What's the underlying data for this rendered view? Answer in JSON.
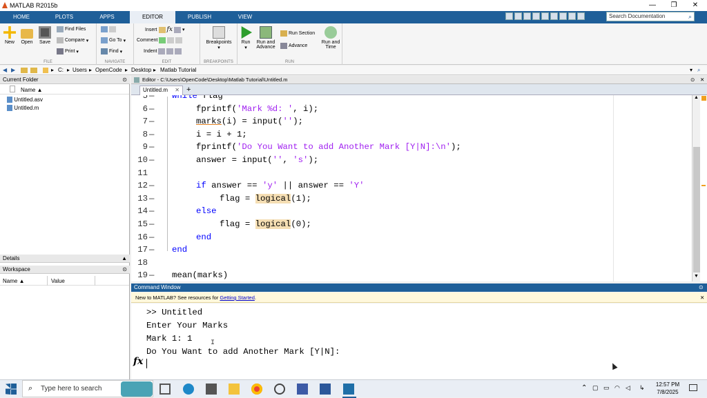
{
  "window": {
    "title": "MATLAB R2015b",
    "min": "—",
    "max": "❐",
    "close": "✕"
  },
  "ribbon_tabs": [
    "HOME",
    "PLOTS",
    "APPS",
    "EDITOR",
    "PUBLISH",
    "VIEW"
  ],
  "search": {
    "placeholder": "Search Documentation"
  },
  "ribbon": {
    "file": {
      "new": "New",
      "open": "Open",
      "save": "Save",
      "find_files": "Find Files",
      "compare": "Compare",
      "print": "Print",
      "group": "FILE"
    },
    "navigate": {
      "go_to": "Go To",
      "find": "Find",
      "group": "NAVIGATE"
    },
    "edit": {
      "insert": "Insert",
      "comment": "Comment",
      "indent": "Indent",
      "group": "EDIT"
    },
    "breakpoints": {
      "label": "Breakpoints",
      "group": "BREAKPOINTS"
    },
    "run": {
      "run": "Run",
      "run_advance": "Run and Advance",
      "run_section": "Run Section",
      "advance": "Advance",
      "run_time": "Run and Time",
      "group": "RUN"
    }
  },
  "address": {
    "drive": "C:",
    "parts": [
      "Users",
      "OpenCode",
      "Desktop",
      "Matlab Tutorial"
    ]
  },
  "current_folder": {
    "title": "Current Folder",
    "col_name": "Name ▲",
    "files": [
      "Untitled.asv",
      "Untitled.m"
    ]
  },
  "details": {
    "title": "Details"
  },
  "workspace": {
    "title": "Workspace",
    "col_name": "Name ▲",
    "col_value": "Value"
  },
  "editor": {
    "header": "Editor - C:\\Users\\OpenCode\\Desktop\\Matlab Tutorial\\Untitled.m",
    "tab": "Untitled.m",
    "lines": [
      {
        "n": "5",
        "dash": "—",
        "indent": 1,
        "parts": [
          {
            "t": "while",
            "c": "kw"
          },
          {
            "t": " flag",
            "c": ""
          }
        ]
      },
      {
        "n": "6",
        "dash": "—",
        "indent": 2,
        "parts": [
          {
            "t": "fprintf(",
            "c": ""
          },
          {
            "t": "'Mark %d: '",
            "c": "st"
          },
          {
            "t": ", i);",
            "c": ""
          }
        ]
      },
      {
        "n": "7",
        "dash": "—",
        "indent": 2,
        "parts": [
          {
            "t": "marks",
            "c": "ul"
          },
          {
            "t": "(i) = input(",
            "c": ""
          },
          {
            "t": "''",
            "c": "st"
          },
          {
            "t": ");",
            "c": ""
          }
        ]
      },
      {
        "n": "8",
        "dash": "—",
        "indent": 2,
        "parts": [
          {
            "t": "i = i + 1;",
            "c": ""
          }
        ]
      },
      {
        "n": "9",
        "dash": "—",
        "indent": 2,
        "parts": [
          {
            "t": "fprintf(",
            "c": ""
          },
          {
            "t": "'Do You Want to add Another Mark [Y|N]:\\n'",
            "c": "st"
          },
          {
            "t": ");",
            "c": ""
          }
        ]
      },
      {
        "n": "10",
        "dash": "—",
        "indent": 2,
        "parts": [
          {
            "t": "answer = input(",
            "c": ""
          },
          {
            "t": "''",
            "c": "st"
          },
          {
            "t": ", ",
            "c": ""
          },
          {
            "t": "'s'",
            "c": "st"
          },
          {
            "t": ");",
            "c": ""
          }
        ]
      },
      {
        "n": "11",
        "dash": "",
        "indent": 0,
        "parts": []
      },
      {
        "n": "12",
        "dash": "—",
        "indent": 2,
        "parts": [
          {
            "t": "if",
            "c": "kw"
          },
          {
            "t": " answer == ",
            "c": ""
          },
          {
            "t": "'y'",
            "c": "st"
          },
          {
            "t": " || answer == ",
            "c": ""
          },
          {
            "t": "'Y'",
            "c": "st"
          }
        ]
      },
      {
        "n": "13",
        "dash": "—",
        "indent": 3,
        "parts": [
          {
            "t": "flag = ",
            "c": ""
          },
          {
            "t": "logical",
            "c": "hl"
          },
          {
            "t": "(1);",
            "c": ""
          }
        ]
      },
      {
        "n": "14",
        "dash": "—",
        "indent": 2,
        "parts": [
          {
            "t": "else",
            "c": "kw"
          }
        ]
      },
      {
        "n": "15",
        "dash": "—",
        "indent": 3,
        "parts": [
          {
            "t": "flag = ",
            "c": ""
          },
          {
            "t": "logical",
            "c": "hl"
          },
          {
            "t": "(0);",
            "c": ""
          }
        ]
      },
      {
        "n": "16",
        "dash": "—",
        "indent": 2,
        "parts": [
          {
            "t": "end",
            "c": "kw"
          }
        ]
      },
      {
        "n": "17",
        "dash": "—",
        "indent": 1,
        "parts": [
          {
            "t": "end",
            "c": "kw"
          }
        ]
      },
      {
        "n": "18",
        "dash": "",
        "indent": 0,
        "parts": []
      },
      {
        "n": "19",
        "dash": "—",
        "indent": 1,
        "parts": [
          {
            "t": "mean(marks)",
            "c": ""
          }
        ]
      }
    ]
  },
  "command_window": {
    "title": "Command Window",
    "notice_prefix": "New to MATLAB? See resources for ",
    "notice_link": "Getting Started",
    "notice_suffix": ".",
    "lines": [
      ">> Untitled",
      "Enter Your Marks",
      "Mark 1: 1",
      "Do You Want to add Another Mark [Y|N]:"
    ],
    "prompt": "fx"
  },
  "taskbar": {
    "search_placeholder": "Type here to search",
    "time": "12:57 PM",
    "date": "7/8/2025"
  }
}
